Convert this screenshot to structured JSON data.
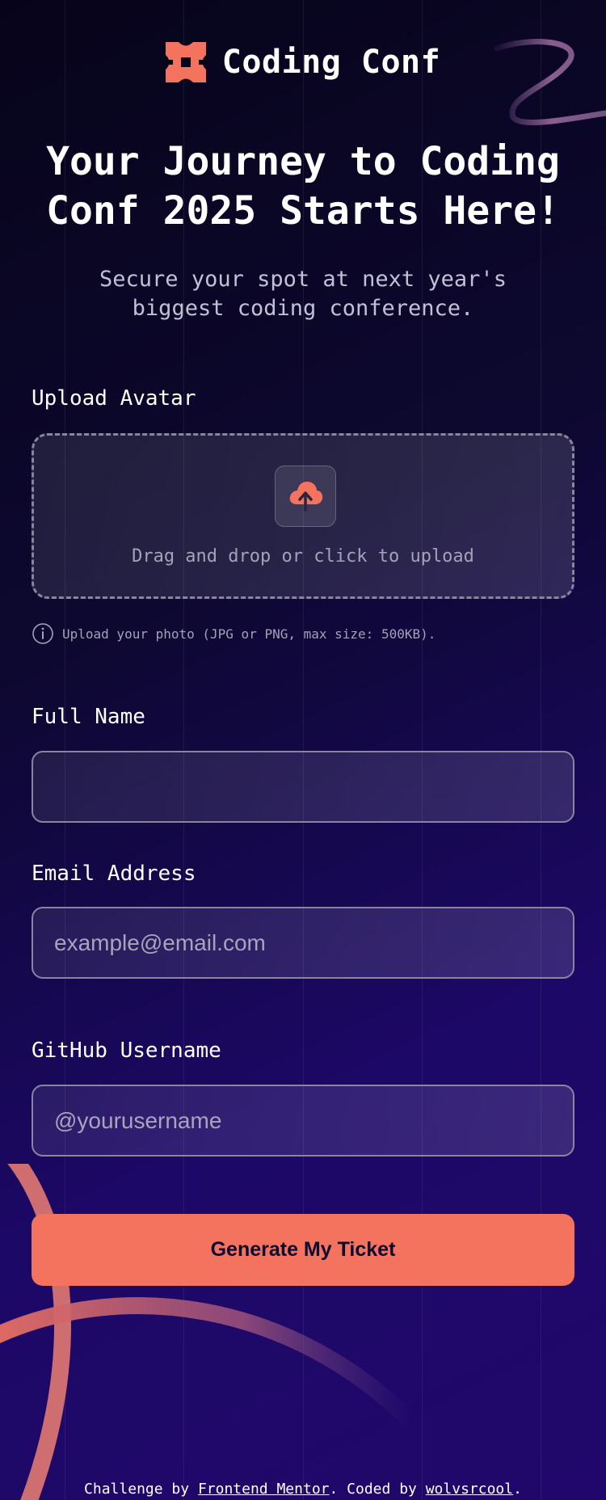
{
  "brand": {
    "name": "Coding Conf",
    "logo_icon": "coding-conf-logo-icon",
    "accent_color": "#f4735e"
  },
  "hero": {
    "title_line1": "Your Journey to Coding",
    "title_line2": "Conf 2025 Starts Here!",
    "subtitle": "Secure your spot at next year's biggest coding conference."
  },
  "form": {
    "avatar": {
      "label": "Upload Avatar",
      "dropzone_text": "Drag and drop or click to upload",
      "upload_icon": "cloud-upload-icon",
      "hint_icon": "info-icon",
      "hint": "Upload your photo (JPG or PNG, max size: 500KB)."
    },
    "full_name": {
      "label": "Full Name",
      "value": "",
      "placeholder": ""
    },
    "email": {
      "label": "Email Address",
      "value": "",
      "placeholder": "example@email.com"
    },
    "github": {
      "label": "GitHub Username",
      "value": "",
      "placeholder": "@yourusername"
    },
    "submit_label": "Generate My Ticket"
  },
  "footer": {
    "prefix": "Challenge by ",
    "link1": "Frontend Mentor",
    "middle": ". Coded by ",
    "link2": "wolvsrcool",
    "suffix": "."
  }
}
